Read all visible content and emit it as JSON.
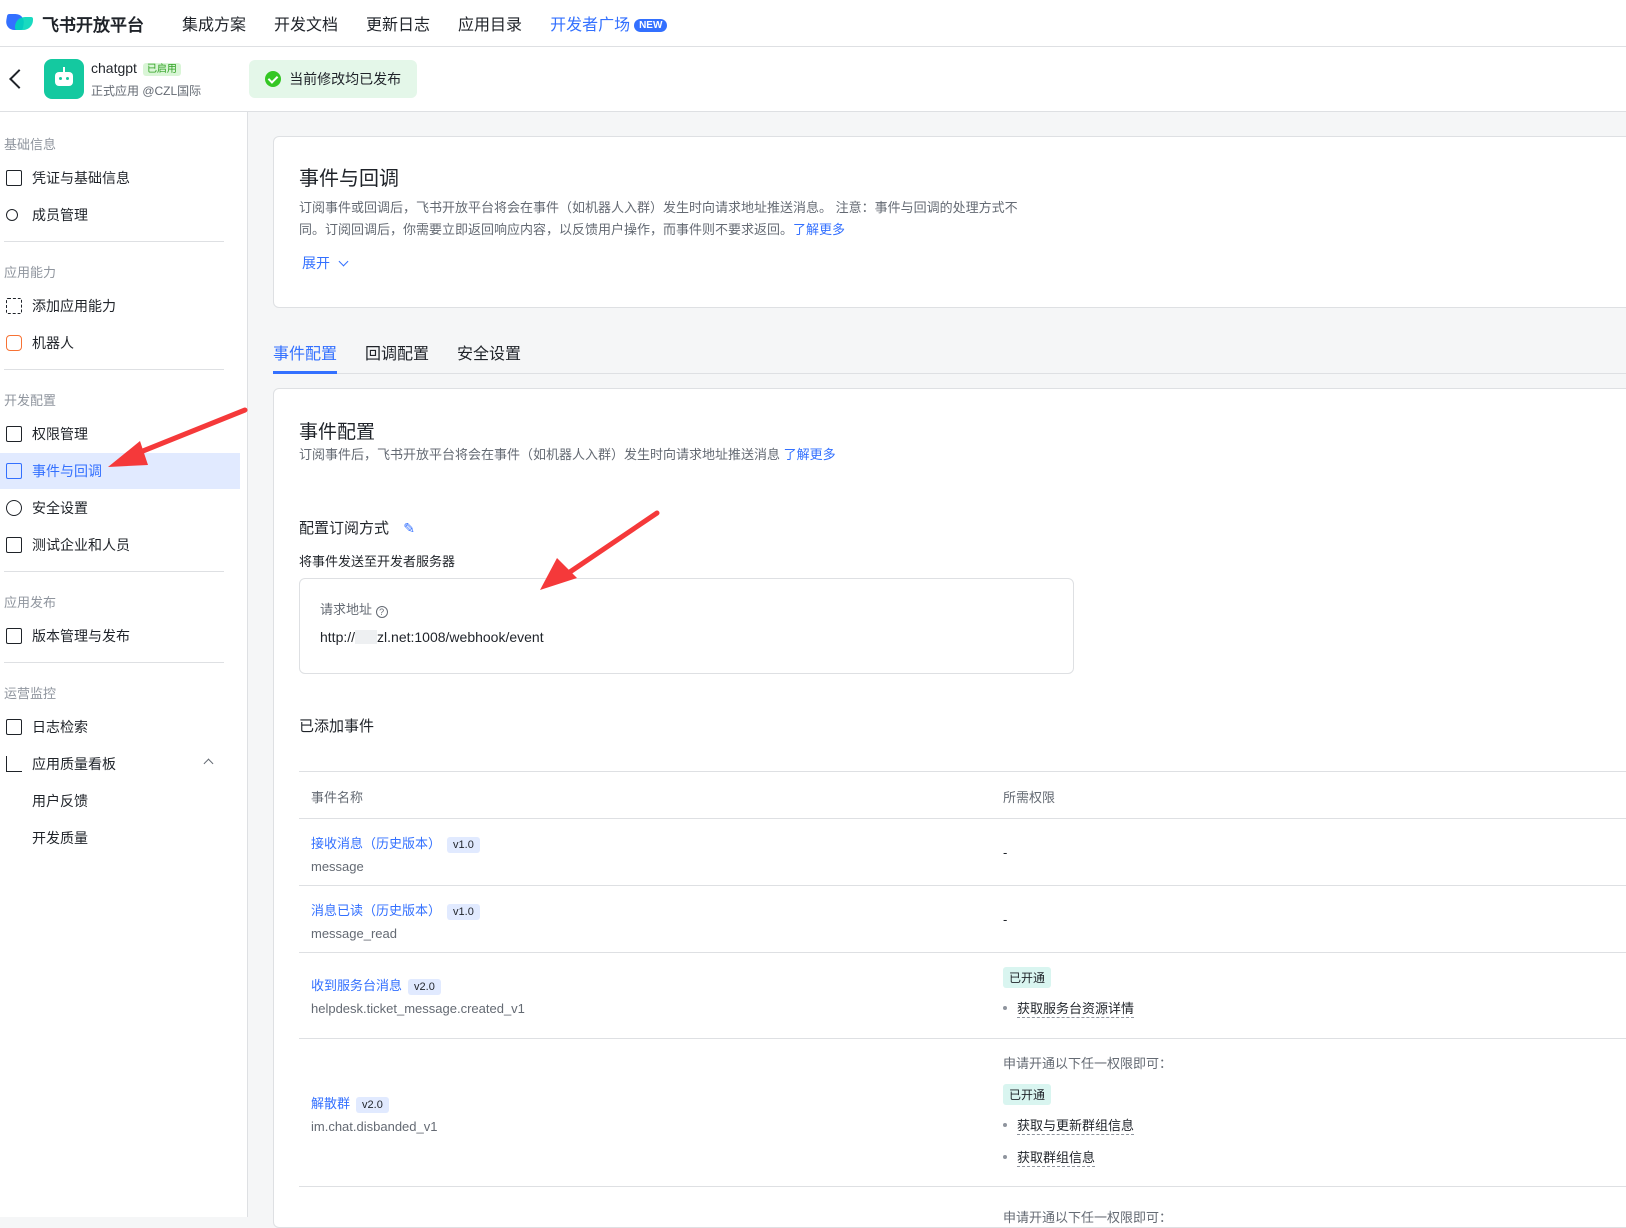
{
  "topnav": {
    "brand": "飞书开放平台",
    "items": [
      "集成方案",
      "开发文档",
      "更新日志",
      "应用目录",
      "开发者广场"
    ],
    "new_badge": "NEW"
  },
  "app": {
    "name": "chatgpt",
    "status_tag": "已启用",
    "subtitle": "正式应用 @CZL国际",
    "publish_note": "当前修改均已发布"
  },
  "sidebar": {
    "sections": [
      "基础信息",
      "应用能力",
      "开发配置",
      "应用发布",
      "运营监控"
    ],
    "items": [
      {
        "label": "凭证与基础信息",
        "icon": "credential-icon"
      },
      {
        "label": "成员管理",
        "icon": "member-icon"
      },
      {
        "label": "添加应用能力",
        "icon": "add-ability-icon"
      },
      {
        "label": "机器人",
        "icon": "robot-icon"
      },
      {
        "label": "权限管理",
        "icon": "permission-icon"
      },
      {
        "label": "事件与回调",
        "icon": "event-icon"
      },
      {
        "label": "安全设置",
        "icon": "shield-icon"
      },
      {
        "label": "测试企业和人员",
        "icon": "code-icon"
      },
      {
        "label": "版本管理与发布",
        "icon": "upload-icon"
      },
      {
        "label": "日志检索",
        "icon": "log-search-icon"
      },
      {
        "label": "应用质量看板",
        "icon": "chart-icon"
      },
      {
        "label": "用户反馈",
        "icon": ""
      },
      {
        "label": "开发质量",
        "icon": ""
      }
    ]
  },
  "intro": {
    "title": "事件与回调",
    "desc_line1": "订阅事件或回调后，飞书开放平台将会在事件（如机器人入群）发生时向请求地址推送消息。 注意：事件与回调的处理方式不",
    "desc_line2": "同。订阅回调后，你需要立即返回响应内容，以反馈用户操作，而事件则不要求返回。",
    "learn_more": "了解更多",
    "expand": "展开"
  },
  "tabs": [
    "事件配置",
    "回调配置",
    "安全设置"
  ],
  "event_config": {
    "title": "事件配置",
    "desc": "订阅事件后，飞书开放平台将会在事件（如机器人入群）发生时向请求地址推送消息",
    "learn_more": "了解更多",
    "subscribe_mode_label": "配置订阅方式",
    "subscribe_mode_value": "将事件发送至开发者服务器",
    "request_url_label": "请求地址",
    "request_url_prefix": "http://",
    "request_url_suffix": "zl.net:1008/webhook/event",
    "added_events_title": "已添加事件",
    "columns": [
      "事件名称",
      "所需权限"
    ],
    "rows": [
      {
        "name": "接收消息（历史版本）",
        "version": "v1.0",
        "key": "message",
        "perm": "-"
      },
      {
        "name": "消息已读（历史版本）",
        "version": "v1.0",
        "key": "message_read",
        "perm": "-"
      },
      {
        "name": "收到服务台消息",
        "version": "v2.0",
        "key": "helpdesk.ticket_message.created_v1",
        "status": "已开通",
        "perms": [
          "获取服务台资源详情"
        ]
      },
      {
        "name": "解散群",
        "version": "v2.0",
        "key": "im.chat.disbanded_v1",
        "hint": "申请开通以下任一权限即可：",
        "status": "已开通",
        "perms": [
          "获取与更新群组信息",
          "获取群组信息"
        ]
      }
    ],
    "next_hint": "申请开通以下任一权限即可："
  }
}
